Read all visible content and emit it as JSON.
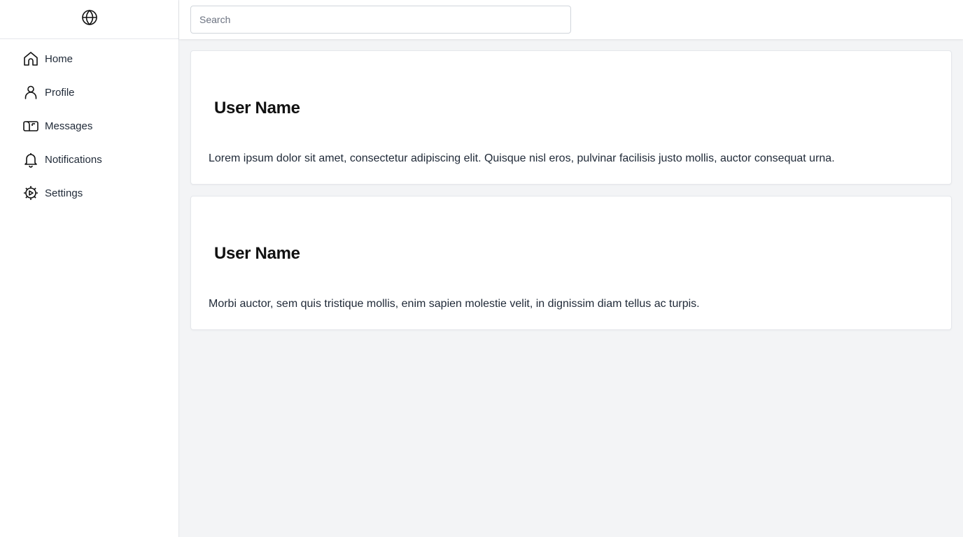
{
  "app": {
    "logo_icon": "globe-icon"
  },
  "search": {
    "placeholder": "Search",
    "value": ""
  },
  "sidebar": {
    "items": [
      {
        "label": "Home",
        "icon": "home-icon"
      },
      {
        "label": "Profile",
        "icon": "user-icon"
      },
      {
        "label": "Messages",
        "icon": "mailbox-icon"
      },
      {
        "label": "Notifications",
        "icon": "bell-icon"
      },
      {
        "label": "Settings",
        "icon": "gear-icon"
      }
    ]
  },
  "posts": [
    {
      "author": "User Name",
      "text": "Lorem ipsum dolor sit amet, consectetur adipiscing elit. Quisque nisl eros, pulvinar facilisis justo mollis, auctor consequat urna."
    },
    {
      "author": "User Name",
      "text": "Morbi auctor, sem quis tristique mollis, enim sapien molestie velit, in dignissim diam tellus ac turpis."
    }
  ],
  "colors": {
    "background": "#f3f4f6",
    "surface": "#ffffff",
    "border": "#e5e7eb",
    "text": "#111827"
  }
}
